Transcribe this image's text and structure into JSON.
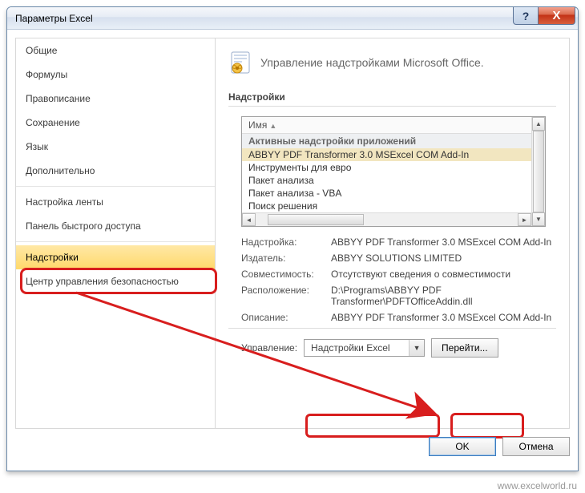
{
  "window": {
    "title": "Параметры Excel"
  },
  "sidebar": {
    "items": [
      {
        "label": "Общие"
      },
      {
        "label": "Формулы"
      },
      {
        "label": "Правописание"
      },
      {
        "label": "Сохранение"
      },
      {
        "label": "Язык"
      },
      {
        "label": "Дополнительно"
      },
      {
        "label": "Настройка ленты"
      },
      {
        "label": "Панель быстрого доступа"
      },
      {
        "label": "Надстройки"
      },
      {
        "label": "Центр управления безопасностью"
      }
    ],
    "selected_index": 8
  },
  "content": {
    "title": "Управление надстройками Microsoft Office.",
    "section": "Надстройки",
    "list": {
      "header": "Имя",
      "group": "Активные надстройки приложений",
      "rows": [
        "ABBYY PDF Transformer 3.0 MSExcel COM Add-In",
        "Инструменты для евро",
        "Пакет анализа",
        "Пакет анализа - VBA",
        "Поиск решения"
      ],
      "selected_index": 0
    },
    "details": {
      "addin_label": "Надстройка:",
      "addin_value": "ABBYY PDF Transformer 3.0 MSExcel COM Add-In",
      "publisher_label": "Издатель:",
      "publisher_value": "ABBYY SOLUTIONS LIMITED",
      "compat_label": "Совместимость:",
      "compat_value": "Отсутствуют сведения о совместимости",
      "location_label": "Расположение:",
      "location_value": "D:\\Programs\\ABBYY PDF Transformer\\PDFTOfficeAddin.dll",
      "description_label": "Описание:",
      "description_value": "ABBYY PDF Transformer 3.0 MSExcel COM Add-In"
    },
    "manage": {
      "label": "Управление:",
      "selected": "Надстройки Excel",
      "go": "Перейти..."
    }
  },
  "buttons": {
    "ok": "OK",
    "cancel": "Отмена"
  },
  "watermark": "www.excelworld.ru"
}
